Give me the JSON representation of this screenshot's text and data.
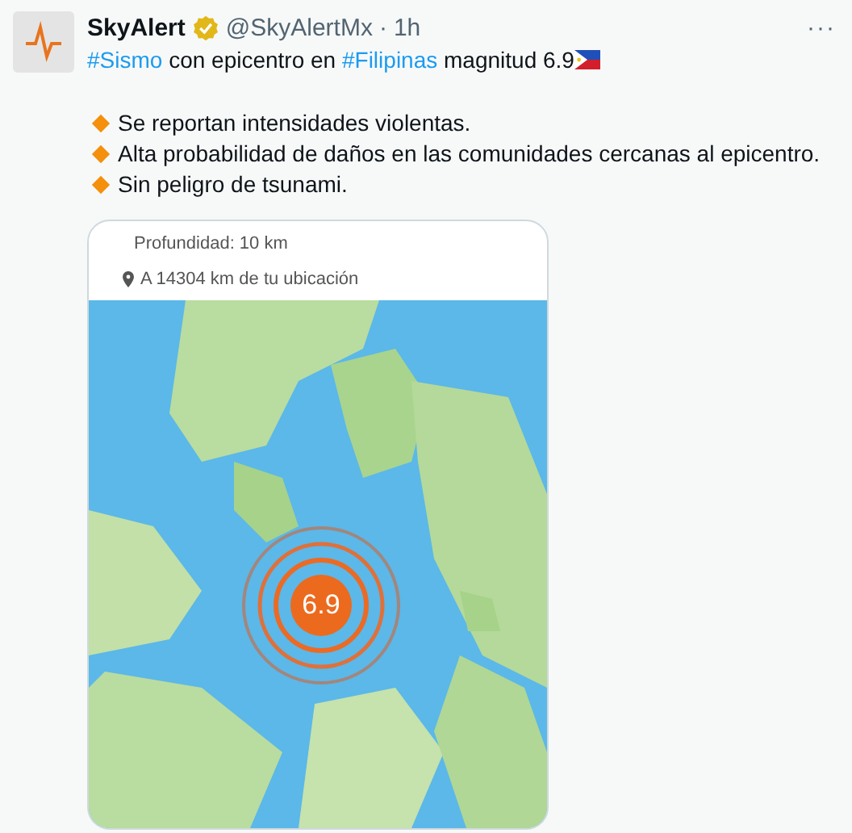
{
  "post": {
    "author": "SkyAlert",
    "verified": true,
    "handle": "@SkyAlertMx",
    "separator": "·",
    "time": "1h",
    "more": "···",
    "headline": [
      {
        "kind": "hashtag",
        "text": "#Sismo"
      },
      {
        "kind": "plain",
        "text": " con epicentro en "
      },
      {
        "kind": "hashtag",
        "text": "#Filipinas"
      },
      {
        "kind": "plain",
        "text": " magnitud 6.9"
      }
    ],
    "bullets": [
      "Se reportan intensidades violentas.",
      "Alta probabilidad de daños en las comunidades cercanas al epicentro.",
      "Sin peligro de tsunami."
    ],
    "media": {
      "depth": "Profundidad: 10 km",
      "distance": "A 14304 km de tu ubicación",
      "epicenter_marker": {
        "magnitude": "6.9"
      }
    }
  }
}
